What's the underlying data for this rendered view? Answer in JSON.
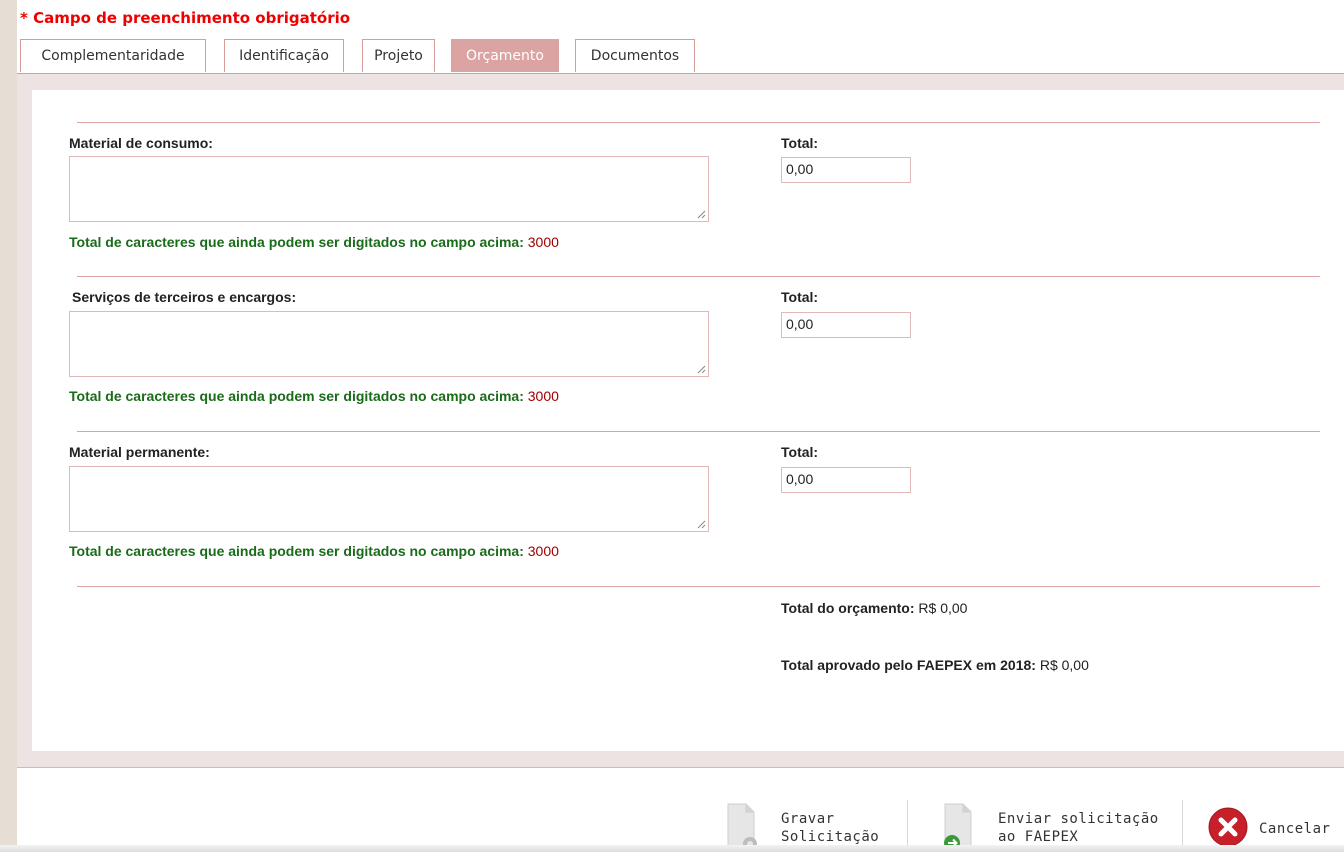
{
  "required_note": "* Campo de preenchimento obrigatório",
  "tabs": [
    {
      "label": "Complementaridade",
      "active": false
    },
    {
      "label": "Identificação",
      "active": false
    },
    {
      "label": "Projeto",
      "active": false
    },
    {
      "label": "Orçamento",
      "active": true
    },
    {
      "label": "Documentos",
      "active": false
    }
  ],
  "sections": [
    {
      "label": "Material de consumo:",
      "total_label": "Total:",
      "total_value": "0,00",
      "description": "",
      "counter_text": "Total de caracteres que ainda podem ser digitados no campo acima:",
      "counter_value": "3000"
    },
    {
      "label": "Serviços de terceiros e encargos:",
      "total_label": "Total:",
      "total_value": "0,00",
      "description": "",
      "counter_text": "Total de caracteres que ainda podem ser digitados no campo acima:",
      "counter_value": "3000"
    },
    {
      "label": "Material permanente:",
      "total_label": "Total:",
      "total_value": "0,00",
      "description": "",
      "counter_text": "Total de caracteres que ainda podem ser digitados no campo acima:",
      "counter_value": "3000"
    }
  ],
  "summary": {
    "budget_label": "Total do orçamento:",
    "budget_value": "R$ 0,00",
    "approved_label": "Total aprovado pelo FAEPEX em 2018:",
    "approved_value": "R$ 0,00"
  },
  "actions": {
    "save_label": "Gravar\nSolicitação",
    "save_icon": "save-document-icon",
    "send_label": "Enviar solicitação\nao FAEPEX",
    "send_icon": "send-document-icon",
    "cancel_label": "Cancelar",
    "cancel_icon": "cancel-icon"
  },
  "colors": {
    "required": "#ee0000",
    "tab_border": "#d99a9a",
    "tab_active": "#dca3a3",
    "counter_text": "#1a6b1a",
    "counter_value": "#a00000",
    "cancel_red": "#c8202a"
  }
}
